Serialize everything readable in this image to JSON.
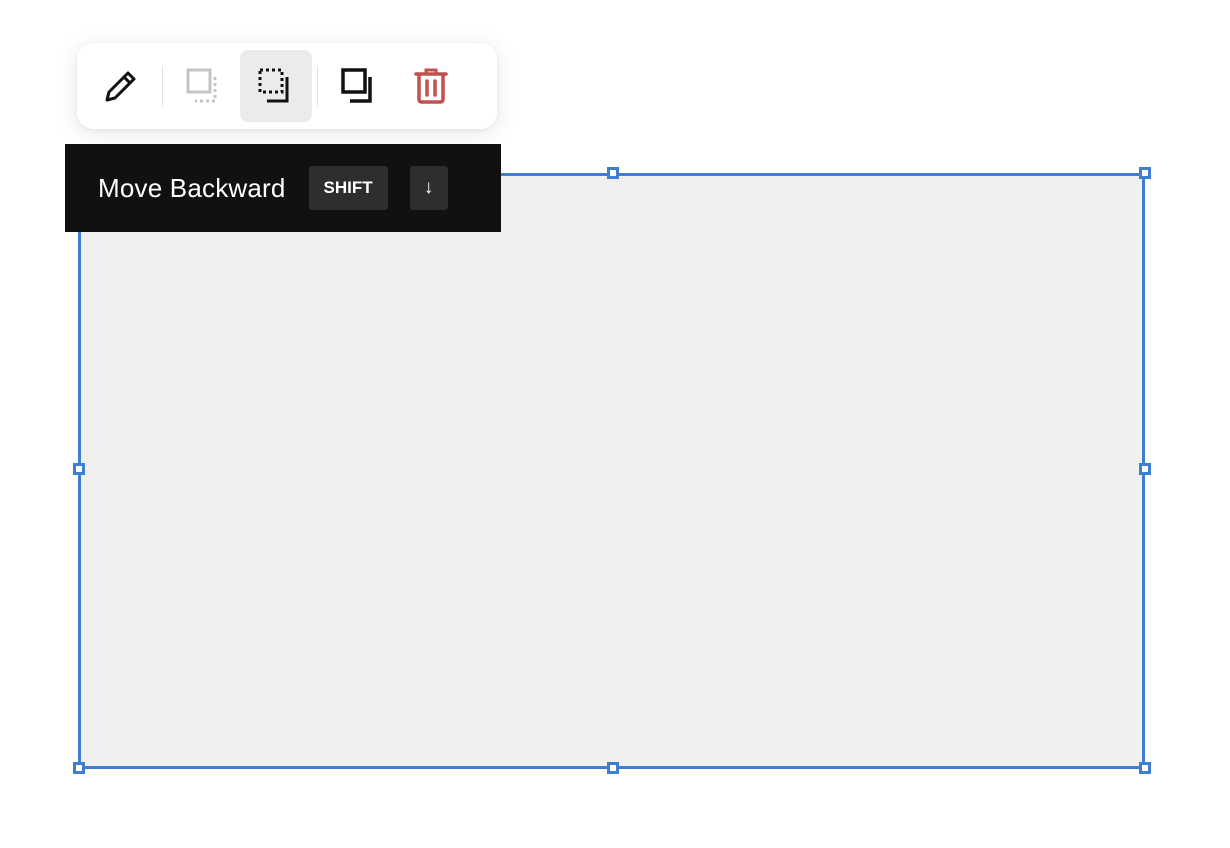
{
  "toolbar": {
    "buttons": [
      {
        "name": "edit",
        "icon": "pencil-icon",
        "state": "enabled"
      },
      {
        "name": "bring-to-front",
        "icon": "bring-to-front-icon",
        "state": "disabled"
      },
      {
        "name": "move-backward",
        "icon": "move-backward-icon",
        "state": "active"
      },
      {
        "name": "duplicate",
        "icon": "duplicate-icon",
        "state": "enabled"
      },
      {
        "name": "delete",
        "icon": "trash-icon",
        "state": "enabled"
      }
    ]
  },
  "tooltip": {
    "label": "Move Backward",
    "shortcut_modifier": "SHIFT",
    "shortcut_key": "↓"
  },
  "colors": {
    "selection": "#3f7fd2",
    "shape_fill": "#f0f0ef",
    "delete": "#c0504d",
    "disabled": "#c4c4c4",
    "tooltip_bg": "#111111"
  }
}
